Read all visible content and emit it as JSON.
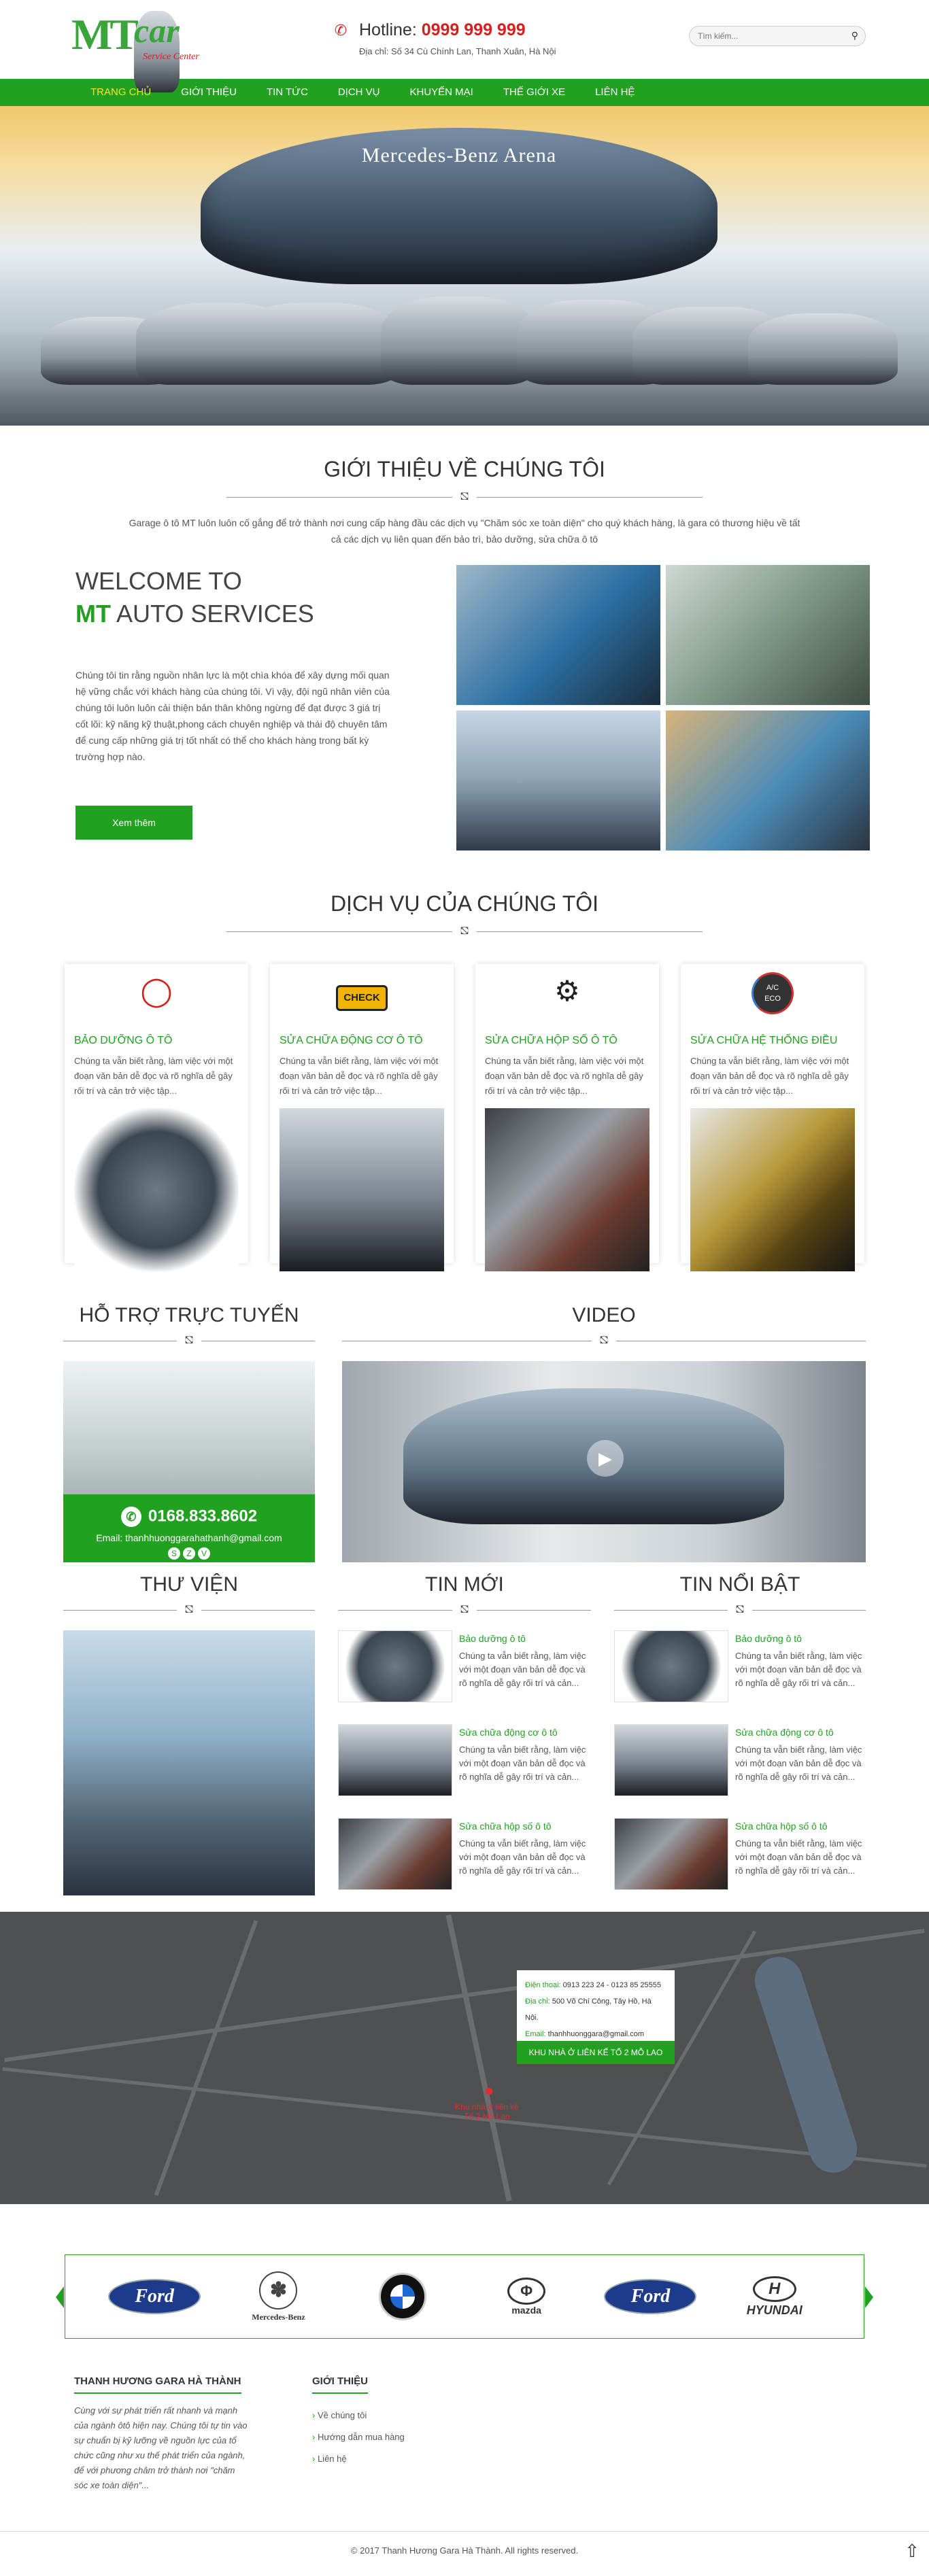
{
  "header": {
    "logo_mt": "MT",
    "logo_car": "car",
    "logo_sub": "Service Center",
    "hotline_label": "Hotline:",
    "hotline_number": "0999 999 999",
    "address": "Địa chỉ: Số 34 Cù Chính Lan, Thanh Xuân, Hà Nội",
    "search_placeholder": "Tìm kiếm..."
  },
  "nav": {
    "items": [
      "Trang chủ",
      "Giới thiệu",
      "Tin tức",
      "Dịch vụ",
      "Khuyến mại",
      "Thế giới xe",
      "Liên hệ"
    ]
  },
  "hero": {
    "arena_text": "Mercedes-Benz Arena"
  },
  "about": {
    "title": "Giới thiệu về chúng tôi",
    "intro": "Garage ô tô MT luôn luôn cố gắng để trở thành nơi cung cấp hàng đầu các dịch vụ \"Chăm sóc xe toàn diện\" cho quý khách hàng, là gara có thương hiệu về tất cả các dịch vụ liên quan đến bảo trì, bảo dưỡng, sửa chữa ô tô",
    "welcome_line1": "WELCOME TO",
    "welcome_mt": "MT",
    "welcome_line2": "AUTO SERVICES",
    "text": "Chúng tôi tin rằng nguồn nhân lực là một chìa khóa để xây dựng mối quan hệ vững chắc với khách hàng của chúng tôi. Vì vậy, đội ngũ nhân viên của chúng tôi luôn luôn cải thiện bản thân không ngừng để đạt được 3 giá trị cốt lõi: kỹ năng kỹ thuật,phong cách chuyên nghiệp và thái độ chuyên tâm để cung cấp những giá trị tốt nhất có thể cho khách hàng trong bất kỳ trường hợp nào.",
    "button": "Xem thêm"
  },
  "services": {
    "title": "Dịch vụ của chúng tôi",
    "items": [
      {
        "title": "Bảo dưỡng ô tô",
        "desc": "Chúng ta vẫn biết rằng, làm việc với một đoạn văn bản dễ đọc và rõ nghĩa dễ gây rối trí và cản trở việc tập...",
        "icon": "tire-pressure-icon"
      },
      {
        "title": "Sửa chữa động cơ ô tô",
        "desc": "Chúng ta vẫn biết rằng, làm việc với một đoạn văn bản dễ đọc và rõ nghĩa dễ gây rối trí và cản trở việc tập...",
        "icon": "check-engine-icon",
        "check": "CHECK"
      },
      {
        "title": "Sửa chữa hộp số ô tô",
        "desc": "Chúng ta vẫn biết rằng, làm việc với một đoạn văn bản dễ đọc và rõ nghĩa dễ gây rối trí và cản trở việc tập...",
        "icon": "gear-c-icon"
      },
      {
        "title": "Sửa chữa hệ thống điều",
        "desc": "Chúng ta vẫn biết rằng, làm việc với một đoạn văn bản dễ đọc và rõ nghĩa dễ gây rối trí và cản trở việc tập...",
        "icon": "ac-dial-icon",
        "ac": "A/C",
        "eco": "ECO"
      }
    ]
  },
  "support": {
    "title": "Hỗ trợ trực tuyến",
    "phone": "0168.833.8602",
    "email": "Email: thanhhuonggarahathanh@gmail.com"
  },
  "video": {
    "title": "Video"
  },
  "library": {
    "title": "Thư viện"
  },
  "news": {
    "title": "Tin mới",
    "items": [
      {
        "title": "Bảo dưỡng ô tô",
        "desc": "Chúng ta vẫn biết rằng, làm việc với một đoạn văn bản dễ đọc và rõ nghĩa dễ gây rối trí và cản..."
      },
      {
        "title": "Sửa chữa động cơ ô tô",
        "desc": "Chúng ta vẫn biết rằng, làm việc với một đoạn văn bản dễ đọc và rõ nghĩa dễ gây rối trí và cản..."
      },
      {
        "title": "Sửa chữa hộp số ô tô",
        "desc": "Chúng ta vẫn biết rằng, làm việc với một đoạn văn bản dễ đọc và rõ nghĩa dễ gây rối trí và cản..."
      }
    ]
  },
  "featured": {
    "title": "Tin nổi bật",
    "items": [
      {
        "title": "Bảo dưỡng ô tô",
        "desc": "Chúng ta vẫn biết rằng, làm việc với một đoạn văn bản dễ đọc và rõ nghĩa dễ gây rối trí và cản..."
      },
      {
        "title": "Sửa chữa động cơ ô tô",
        "desc": "Chúng ta vẫn biết rằng, làm việc với một đoạn văn bản dễ đọc và rõ nghĩa dễ gây rối trí và cản..."
      },
      {
        "title": "Sửa chữa hộp số ô tô",
        "desc": "Chúng ta vẫn biết rằng, làm việc với một đoạn văn bản dễ đọc và rõ nghĩa dễ gây rối trí và cản..."
      }
    ]
  },
  "map": {
    "phone_label": "Điện thoại:",
    "phone": "0913 223 24 - 0123 85 25555",
    "address_label": "Địa chỉ:",
    "address": "500 Võ Chí Công, Tây Hồ, Hà Nội.",
    "email_label": "Email:",
    "email": "thanhhuonggara@gmail.com",
    "marker_label": "KHU NHÀ Ở LIÊN KẾ TỔ 2 MỖ LAO",
    "pin_text": "Khu nhà ở liên kề Tổ 2 Mỗ Lao"
  },
  "brands": {
    "ford": "Ford",
    "mercedes": "Mercedes-Benz",
    "bmw": "BMW",
    "mazda": "mazda",
    "hyundai": "HYUNDAI"
  },
  "footer": {
    "col1_title": "Thanh Hương Gara Hà Thành",
    "col1_text": "Cùng với sự phát triển rất nhanh và mạnh của ngành ôtô hiện nay. Chúng tôi tự tin vào sự chuẩn bị kỹ lưỡng về nguồn lực của tổ chức cũng như xu thế phát triển của ngành, để với phương châm trở thành nơi \"chăm sóc xe toàn diện\"...",
    "col2_title": "Giới thiệu",
    "col2_items": [
      "Về chúng tôi",
      "Hướng dẫn mua hàng",
      "Liên hệ"
    ],
    "copyright": "© 2017 Thanh Hương Gara Hà Thành. All rights reserved."
  },
  "colors": {
    "accent": "#22a020",
    "hotline": "#d61f1f",
    "nav_active": "#f5e52a"
  }
}
